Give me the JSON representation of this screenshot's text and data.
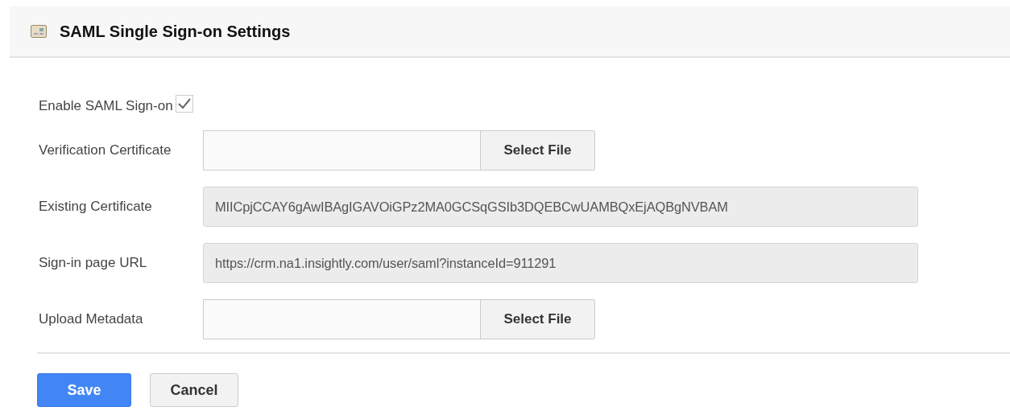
{
  "header": {
    "title": "SAML Single Sign-on Settings"
  },
  "fields": [
    {
      "kind": "checkbox",
      "label": "Enable SAML Sign-on",
      "checked": true
    },
    {
      "kind": "file",
      "label": "Verification Certificate",
      "button": "Select File"
    },
    {
      "kind": "readonly",
      "label": "Existing Certificate",
      "value": "MIICpjCCAY6gAwIBAgIGAVOiGPz2MA0GCSqGSIb3DQEBCwUAMBQxEjAQBgNVBAM"
    },
    {
      "kind": "readonly",
      "label": "Sign-in page URL",
      "value": "https://crm.na1.insightly.com/user/saml?instanceId=911291"
    },
    {
      "kind": "file",
      "label": "Upload Metadata",
      "button": "Select File"
    }
  ],
  "buttons": [
    {
      "kind": "primary",
      "label": "Save"
    },
    {
      "kind": "secondary",
      "label": "Cancel"
    }
  ]
}
